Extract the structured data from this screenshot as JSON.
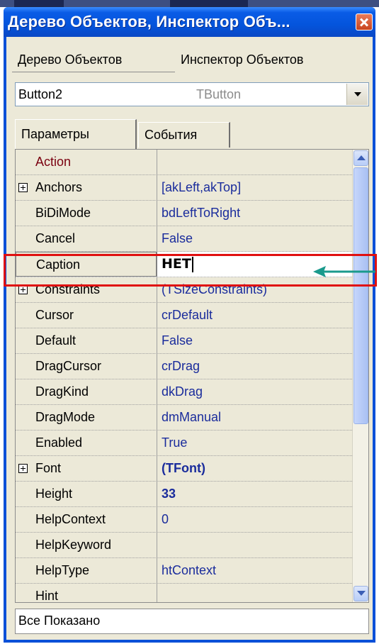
{
  "window": {
    "title": "Дерево Объектов, Инспектор Объ...",
    "close_icon": "close-icon"
  },
  "tabs": [
    {
      "label": "Дерево Объектов",
      "selected": false
    },
    {
      "label": "Инспектор Объектов",
      "selected": true
    }
  ],
  "object_selector": {
    "name": "Button2",
    "type": "TButton"
  },
  "subtabs": [
    {
      "label": "Параметры",
      "selected": true
    },
    {
      "label": "События",
      "selected": false
    }
  ],
  "properties": [
    {
      "name": "Action",
      "value": ""
    },
    {
      "name": "Anchors",
      "value": "[akLeft,akTop]",
      "expandable": true
    },
    {
      "name": "BiDiMode",
      "value": "bdLeftToRight"
    },
    {
      "name": "Cancel",
      "value": "False"
    },
    {
      "name": "Caption",
      "value": "НЕТ",
      "editing": true
    },
    {
      "name": "Constraints",
      "value": "(TSizeConstraints)",
      "expandable": true
    },
    {
      "name": "Cursor",
      "value": "crDefault"
    },
    {
      "name": "Default",
      "value": "False"
    },
    {
      "name": "DragCursor",
      "value": "crDrag"
    },
    {
      "name": "DragKind",
      "value": "dkDrag"
    },
    {
      "name": "DragMode",
      "value": "dmManual"
    },
    {
      "name": "Enabled",
      "value": "True"
    },
    {
      "name": "Font",
      "value": "(TFont)",
      "expandable": true
    },
    {
      "name": "Height",
      "value": "33"
    },
    {
      "name": "HelpContext",
      "value": "0"
    },
    {
      "name": "HelpKeyword",
      "value": ""
    },
    {
      "name": "HelpType",
      "value": "htContext"
    },
    {
      "name": "Hint",
      "value": ""
    }
  ],
  "status": {
    "text": "Все Показано"
  },
  "colors": {
    "title_bar": "#0454dc",
    "window_bg": "#ece9d8",
    "value_text": "#1a2c9c",
    "highlight": "#e01010",
    "arrow": "#1a9a8c"
  }
}
